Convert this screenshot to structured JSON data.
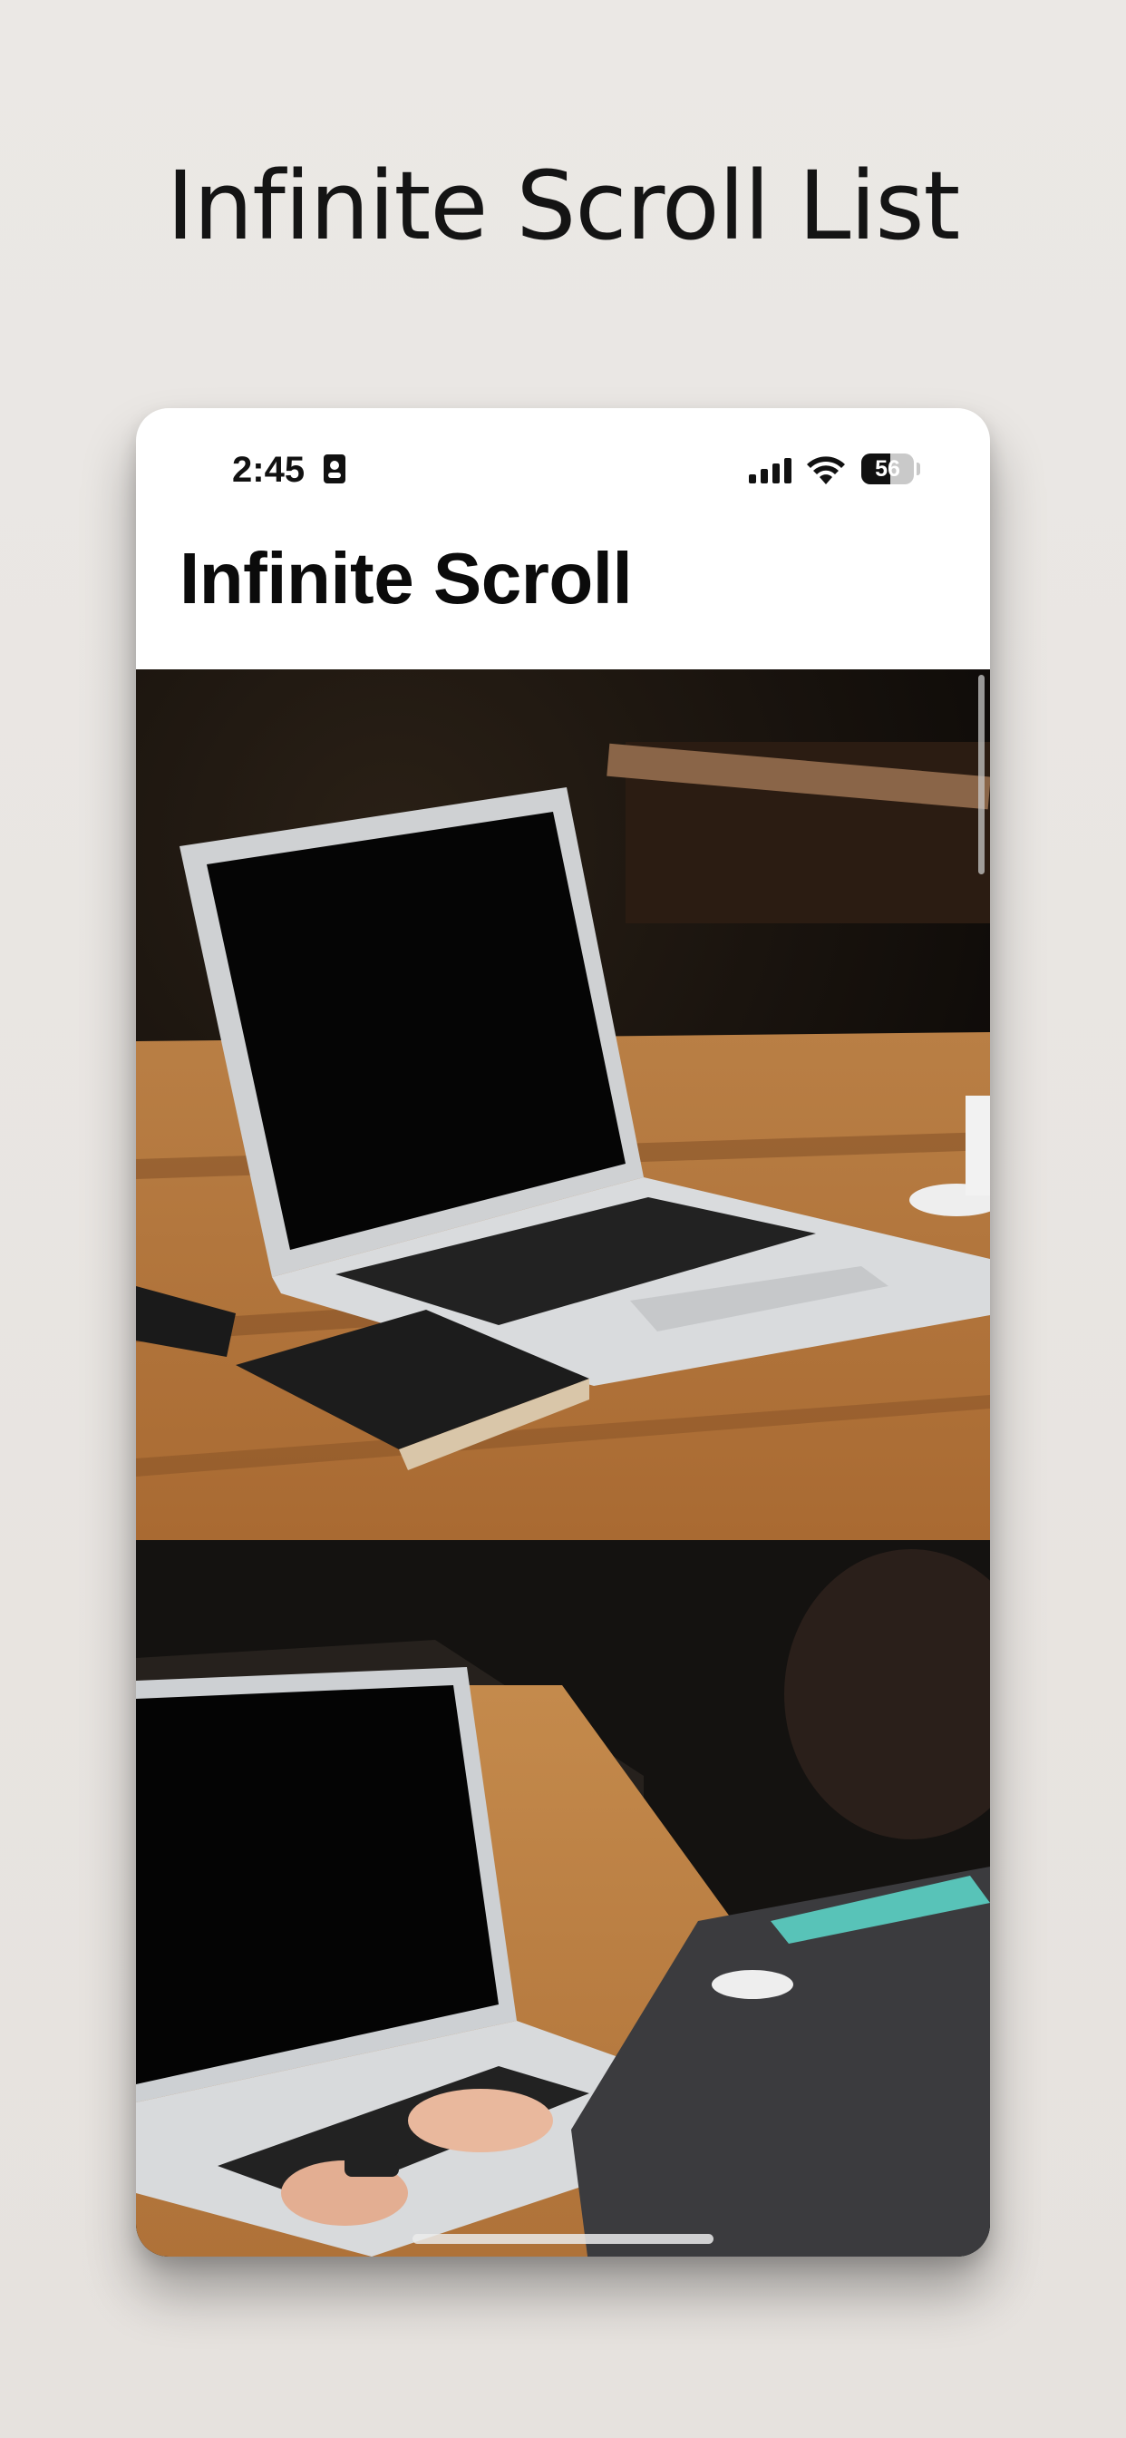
{
  "page": {
    "heading": "Infinite Scroll List"
  },
  "status_bar": {
    "time": "2:45",
    "battery": "56",
    "battery_level": 0.56,
    "icons": [
      "id-card-icon",
      "cellular-signal-icon",
      "wifi-icon",
      "battery-icon"
    ]
  },
  "nav": {
    "title": "Infinite Scroll"
  },
  "feed": {
    "items": [
      {
        "subject": "laptop-on-wooden-table-photo"
      },
      {
        "subject": "person-typing-on-laptop-photo"
      }
    ]
  },
  "colors": {
    "background": "#e9e6e3",
    "heading_text": "#141414",
    "phone_background": "#ffffff",
    "title_text": "#0b0b0b"
  }
}
